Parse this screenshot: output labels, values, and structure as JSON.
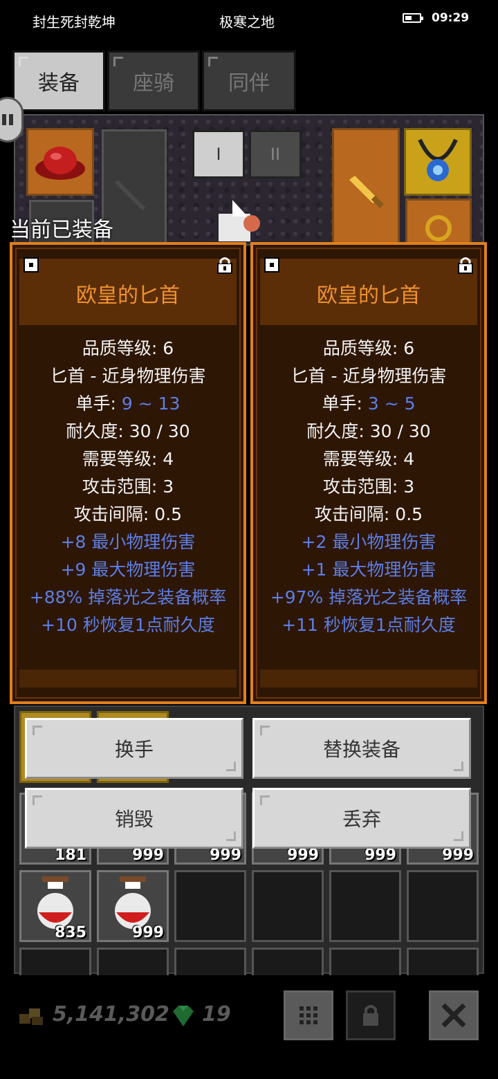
{
  "status_bar": {
    "left_text": "封生死封乾坤",
    "center_text": "极寒之地",
    "time": "09:29"
  },
  "tabs": [
    {
      "label": "装备",
      "active": true
    },
    {
      "label": "座骑",
      "active": false
    },
    {
      "label": "同伴",
      "active": false
    }
  ],
  "scene": {
    "set_buttons": [
      "I",
      "II"
    ]
  },
  "equipped_label": "当前已装备",
  "cards": [
    {
      "title": "欧皇的匕首",
      "quality": "品质等级: 6",
      "type": "匕首 - 近身物理伤害",
      "damage_label": "单手: ",
      "damage_value": "9 ~ 13",
      "durability": "耐久度: 30 / 30",
      "level_req": "需要等级: 4",
      "range": "攻击范围: 3",
      "interval": "攻击间隔: 0.5",
      "bonuses": [
        "+8 最小物理伤害",
        "+9 最大物理伤害",
        "+88% 掉落光之装备概率",
        "+10 秒恢复1点耐久度"
      ]
    },
    {
      "title": "欧皇的匕首",
      "quality": "品质等级: 6",
      "type": "匕首 - 近身物理伤害",
      "damage_label": "单手: ",
      "damage_value": "3 ~ 5",
      "durability": "耐久度: 30 / 30",
      "level_req": "需要等级: 4",
      "range": "攻击范围: 3",
      "interval": "攻击间隔: 0.5",
      "bonuses": [
        "+2 最小物理伤害",
        "+1 最大物理伤害",
        "+97% 掉落光之装备概率",
        "+11 秒恢复1点耐久度"
      ]
    }
  ],
  "actions": {
    "swap_hand": "换手",
    "replace": "替换装备",
    "destroy": "销毁",
    "discard": "丢弃"
  },
  "inventory": {
    "partial_counts": [
      "181",
      "999",
      "999",
      "999",
      "999",
      "999"
    ],
    "potion_counts": [
      "835",
      "999"
    ]
  },
  "footer": {
    "gold": "5,141,302",
    "gems": "19"
  },
  "colors": {
    "accent_orange": "#e0801c",
    "bonus_blue": "#5c7fe6",
    "title_orange": "#f0922e"
  }
}
